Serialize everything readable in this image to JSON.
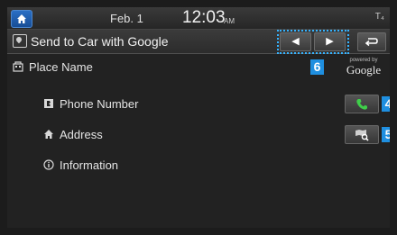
{
  "status_bar": {
    "date": "Feb. 1",
    "time": "12:03",
    "ampm": "AM",
    "status_icon_label": "T₄"
  },
  "title_bar": {
    "title": "Send to Car with Google",
    "prev_glyph": "◀",
    "next_glyph": "▶"
  },
  "callouts": {
    "nav": "6",
    "phone": "4",
    "map": "5"
  },
  "place": {
    "name_label": "Place Name",
    "google_powered": "powered by",
    "google_word": "Google"
  },
  "details": [
    {
      "label": "Phone Number",
      "icon": "phone-book-icon"
    },
    {
      "label": "Address",
      "icon": "home-icon"
    },
    {
      "label": "Information",
      "icon": "info-icon"
    }
  ],
  "colors": {
    "accent_blue": "#1f8fe0",
    "phone_green": "#3fcf4a",
    "callout_outline": "#35b3ff"
  }
}
